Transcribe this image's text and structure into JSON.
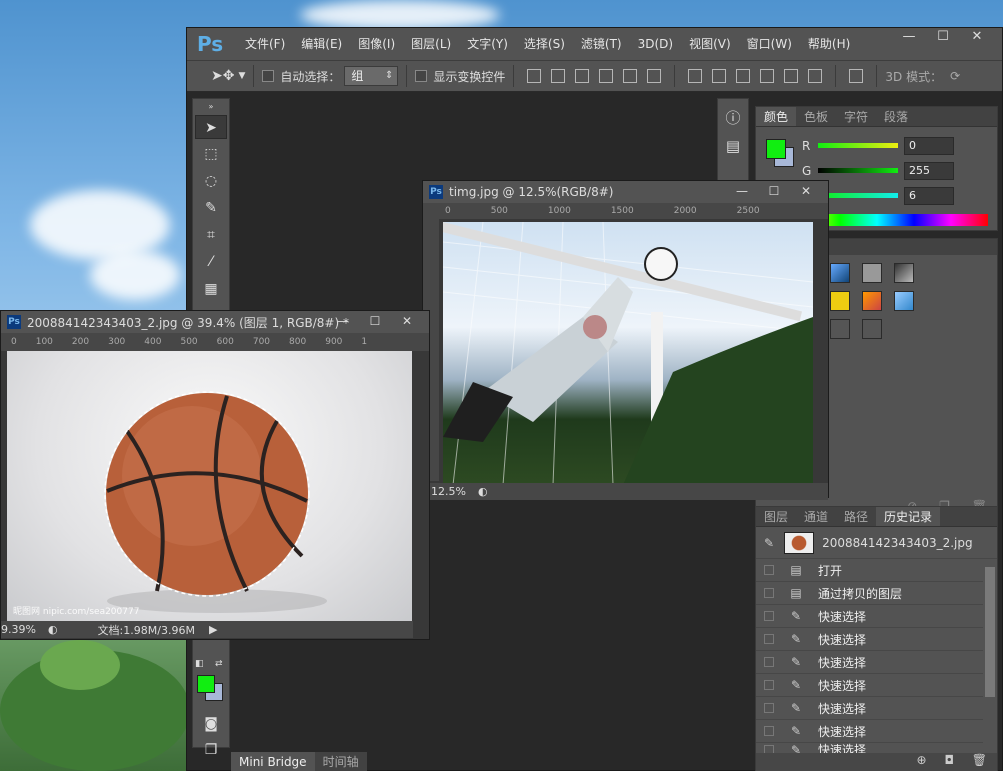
{
  "app": {
    "logo": "Ps",
    "menu": [
      "文件(F)",
      "编辑(E)",
      "图像(I)",
      "图层(L)",
      "文字(Y)",
      "选择(S)",
      "滤镜(T)",
      "3D(D)",
      "视图(V)",
      "窗口(W)",
      "帮助(H)"
    ],
    "window_buttons": [
      "—",
      "☐",
      "✕"
    ]
  },
  "options": {
    "auto_select_label": "自动选择：",
    "auto_select_value": "组",
    "show_transform_label": "显示变换控件",
    "mode_3d_label": "3D 模式："
  },
  "color_panel": {
    "tabs": [
      "颜色",
      "色板",
      "字符",
      "段落"
    ],
    "active_tab": 0,
    "foreground": "#11ee11",
    "background_swatch": "#a8b8d8",
    "channels": [
      {
        "label": "R",
        "value": "0"
      },
      {
        "label": "G",
        "value": "255"
      },
      {
        "label": "B",
        "value": "6"
      }
    ]
  },
  "history_panel": {
    "tabs": [
      "图层",
      "通道",
      "路径",
      "历史记录"
    ],
    "active_tab": 3,
    "snapshot": "200884142343403_2.jpg",
    "entries": [
      "打开",
      "通过拷贝的图层",
      "快速选择",
      "快速选择",
      "快速选择",
      "快速选择",
      "快速选择",
      "快速选择",
      "快速选择"
    ]
  },
  "bottom_tabs": [
    "Mini Bridge",
    "时间轴"
  ],
  "doc_timg": {
    "title": "timg.jpg @ 12.5%(RGB/8#)",
    "zoom": "12.5%",
    "ruler_ticks": [
      "0",
      "500",
      "1000",
      "1500",
      "2000",
      "2500"
    ]
  },
  "doc_ball": {
    "title": "200884142343403_2.jpg @ 39.4% (图层 1, RGB/8#) *",
    "zoom": "9.39%",
    "doc_info": "文档:1.98M/3.96M",
    "ruler_ticks": [
      "0",
      "100",
      "200",
      "300",
      "400",
      "500",
      "600",
      "700",
      "800",
      "900",
      "1"
    ],
    "watermark": "昵图网 nipic.com/sea200777"
  }
}
